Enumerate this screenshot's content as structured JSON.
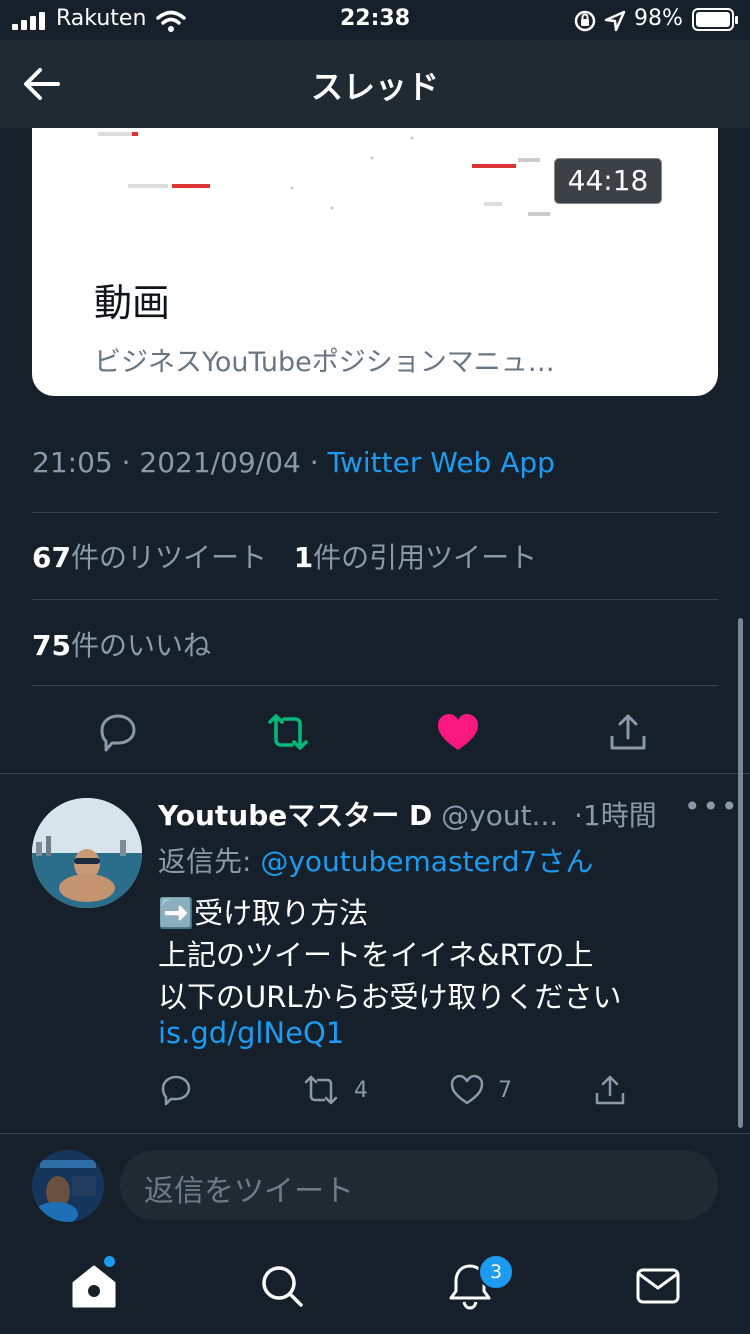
{
  "status_bar": {
    "carrier": "Rakuten",
    "time": "22:38",
    "battery": "98%"
  },
  "header": {
    "title": "スレッド",
    "back_icon": "arrow-left-icon"
  },
  "card": {
    "duration": "44:18",
    "title": "動画",
    "description": "ビジネスYouTubeポジションマニュ…"
  },
  "tweet_meta": {
    "time": "21:05",
    "separator": "·",
    "date": "2021/09/04",
    "source": "Twitter Web App"
  },
  "stats": {
    "retweets_count": "67",
    "retweets_label": "件のリツイート",
    "quotes_count": "1",
    "quotes_label": "件の引用ツイート",
    "likes_count": "75",
    "likes_label": "件のいいね"
  },
  "actions": [
    "reply-icon",
    "retweet-icon",
    "heart-icon",
    "share-icon"
  ],
  "colors": {
    "background": "#15202b",
    "accent": "#1d9bf0",
    "retweet_green": "#00ba7c",
    "like_red": "#f91880",
    "muted": "#8b98a5"
  },
  "reply": {
    "name": "Youtubeマスター D",
    "handle": "@yout...",
    "time": "·1時間",
    "more": "•••",
    "reply_to_label": "返信先:",
    "reply_to_handle": "@youtubemasterd7さん",
    "line1": "➡️受け取り方法",
    "line2": "上記のツイートをイイネ&RTの上",
    "line3": "以下のURLからお受け取りください",
    "link": "is.gd/glNeQ1",
    "retweets": "4",
    "likes": "7"
  },
  "compose": {
    "placeholder": "返信をツイート"
  },
  "tabbar": {
    "items": [
      "home-icon",
      "search-icon",
      "notifications-icon",
      "messages-icon"
    ],
    "notification_badge": "3"
  }
}
